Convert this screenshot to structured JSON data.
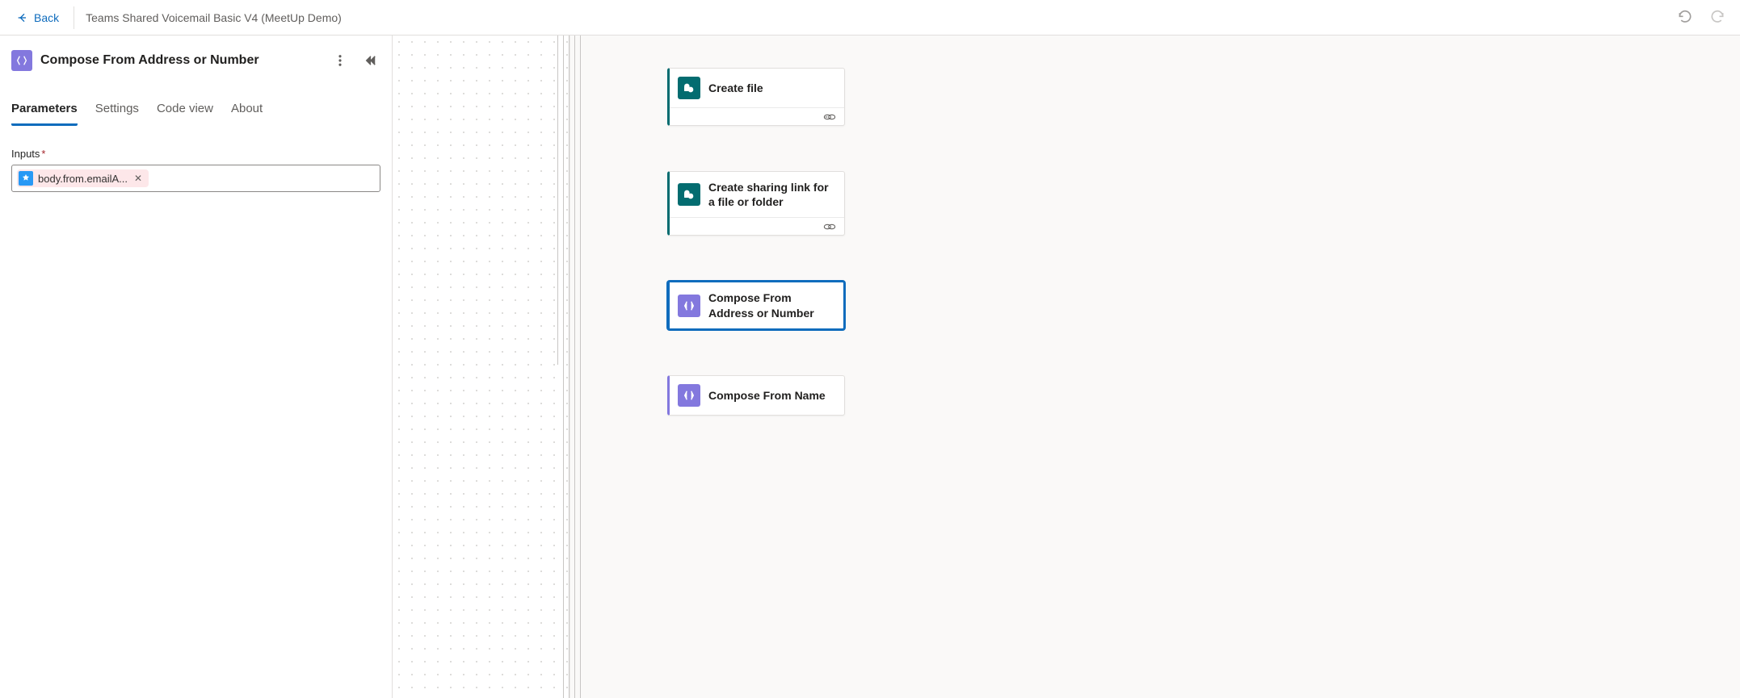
{
  "header": {
    "back_label": "Back",
    "flow_title": "Teams Shared Voicemail Basic V4 (MeetUp Demo)"
  },
  "panel": {
    "title": "Compose From Address or Number",
    "tabs": {
      "parameters": "Parameters",
      "settings": "Settings",
      "code_view": "Code view",
      "about": "About"
    },
    "field_label": "Inputs",
    "token_text": "body.from.emailA..."
  },
  "canvas": {
    "cards": {
      "create_file": "Create file",
      "create_sharing": "Create sharing link for a file or folder",
      "compose_addr": "Compose From Address or Number",
      "compose_name": "Compose From Name"
    }
  }
}
